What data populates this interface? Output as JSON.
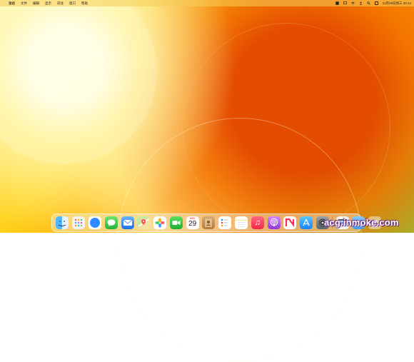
{
  "menubar": {
    "app_name": "访达",
    "items": [
      "文件",
      "编辑",
      "显示",
      "前往",
      "窗口",
      "帮助"
    ],
    "datetime": "11月29日周三 20:14"
  },
  "dock": {
    "apps": [
      {
        "name": "访达",
        "icon": "finder-icon"
      },
      {
        "name": "启动台",
        "icon": "launchpad-icon"
      },
      {
        "name": "Safari浏览器",
        "icon": "safari-icon"
      },
      {
        "name": "信息",
        "icon": "messages-icon"
      },
      {
        "name": "邮件",
        "icon": "mail-icon"
      },
      {
        "name": "地图",
        "icon": "maps-icon"
      },
      {
        "name": "照片",
        "icon": "photos-icon"
      },
      {
        "name": "FaceTime通话",
        "icon": "facetime-icon"
      },
      {
        "name": "日历",
        "icon": "calendar-icon",
        "month": "NOV",
        "day": "29"
      },
      {
        "name": "通讯录",
        "icon": "contacts-icon"
      },
      {
        "name": "提醒事项",
        "icon": "reminders-icon"
      },
      {
        "name": "备忘录",
        "icon": "notes-icon"
      },
      {
        "name": "音乐",
        "icon": "music-icon"
      },
      {
        "name": "播客",
        "icon": "podcasts-icon"
      },
      {
        "name": "新闻",
        "icon": "news-icon"
      },
      {
        "name": "App Store",
        "icon": "appstore-icon"
      },
      {
        "name": "系统设置",
        "icon": "settings-icon"
      }
    ],
    "extras": [
      {
        "name": "预览",
        "icon": "preview-icon"
      },
      {
        "name": "下载",
        "icon": "folder-icon"
      },
      {
        "name": "废纸篓",
        "icon": "trash-icon"
      }
    ]
  },
  "watermark": "acg.inmoke.com",
  "colors": {
    "menubar_bg": "#f5cd5a",
    "wallpaper_yellow": "#ffd21d",
    "wallpaper_orange": "#f07e00",
    "wallpaper_green": "#9fbc42",
    "watermark_outline": "#6b2a88"
  }
}
